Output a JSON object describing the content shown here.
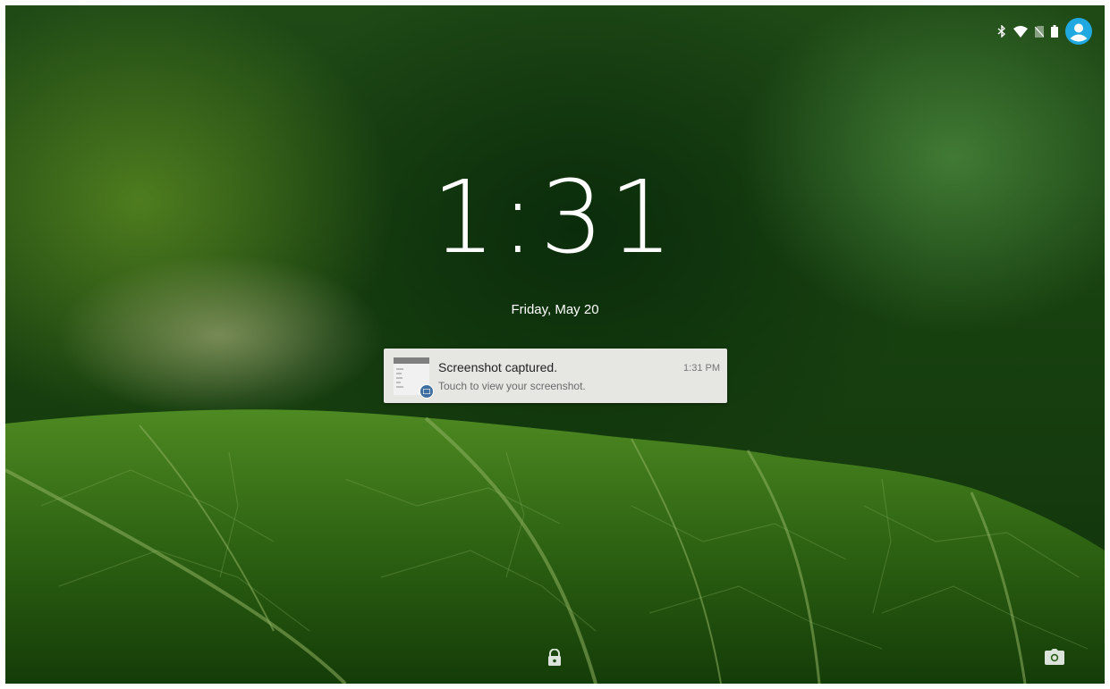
{
  "status_bar": {
    "icons": [
      "bluetooth-icon",
      "wifi-icon",
      "no-sim-icon",
      "battery-icon",
      "user-avatar-icon"
    ],
    "accent_color": "#1fa9e0"
  },
  "lock_screen": {
    "time": "1:31",
    "date": "Friday, May 20"
  },
  "notification": {
    "title": "Screenshot captured.",
    "text": "Touch to view your screenshot.",
    "time": "1:31 PM",
    "icon": "screenshot-thumbnail",
    "badge_icon": "image-icon",
    "badge_color": "#3f6ea0"
  },
  "bottom_bar": {
    "left_icon": "lock-icon",
    "right_icon": "camera-icon"
  },
  "wallpaper": {
    "colors": [
      "#1f4a16",
      "#3f6e14",
      "#8fb85a"
    ]
  }
}
